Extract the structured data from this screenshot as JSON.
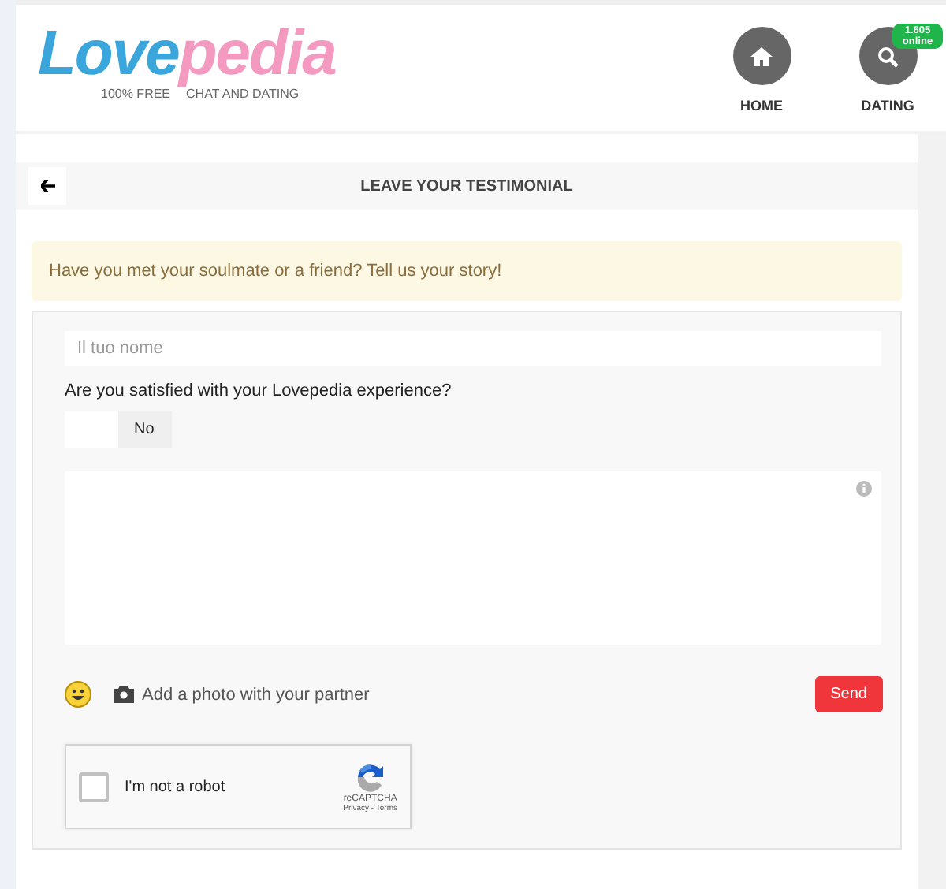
{
  "logo": {
    "first": "Love",
    "second": "pedia",
    "tagline": [
      "100% FREE",
      "CHAT AND DATING"
    ]
  },
  "nav": [
    {
      "label": "HOME",
      "kind": "home"
    },
    {
      "label": "DATING",
      "kind": "search",
      "badge": "1.605 online"
    }
  ],
  "page_title": "LEAVE YOUR TESTIMONIAL",
  "alert": "Have you met your soulmate or a friend? Tell us your story!",
  "form": {
    "name_field": {
      "placeholder": "Il tuo nome"
    },
    "question": "Are you satisfied with your Lovepedia experience?",
    "toggle": {
      "on": false,
      "label": "No"
    },
    "add_photo": "Add a photo with your partner",
    "send": "Send",
    "captcha": {
      "checked": false,
      "label": "I'm not a robot",
      "brand": "reCAPTCHA",
      "links": "Privacy - Terms"
    }
  }
}
